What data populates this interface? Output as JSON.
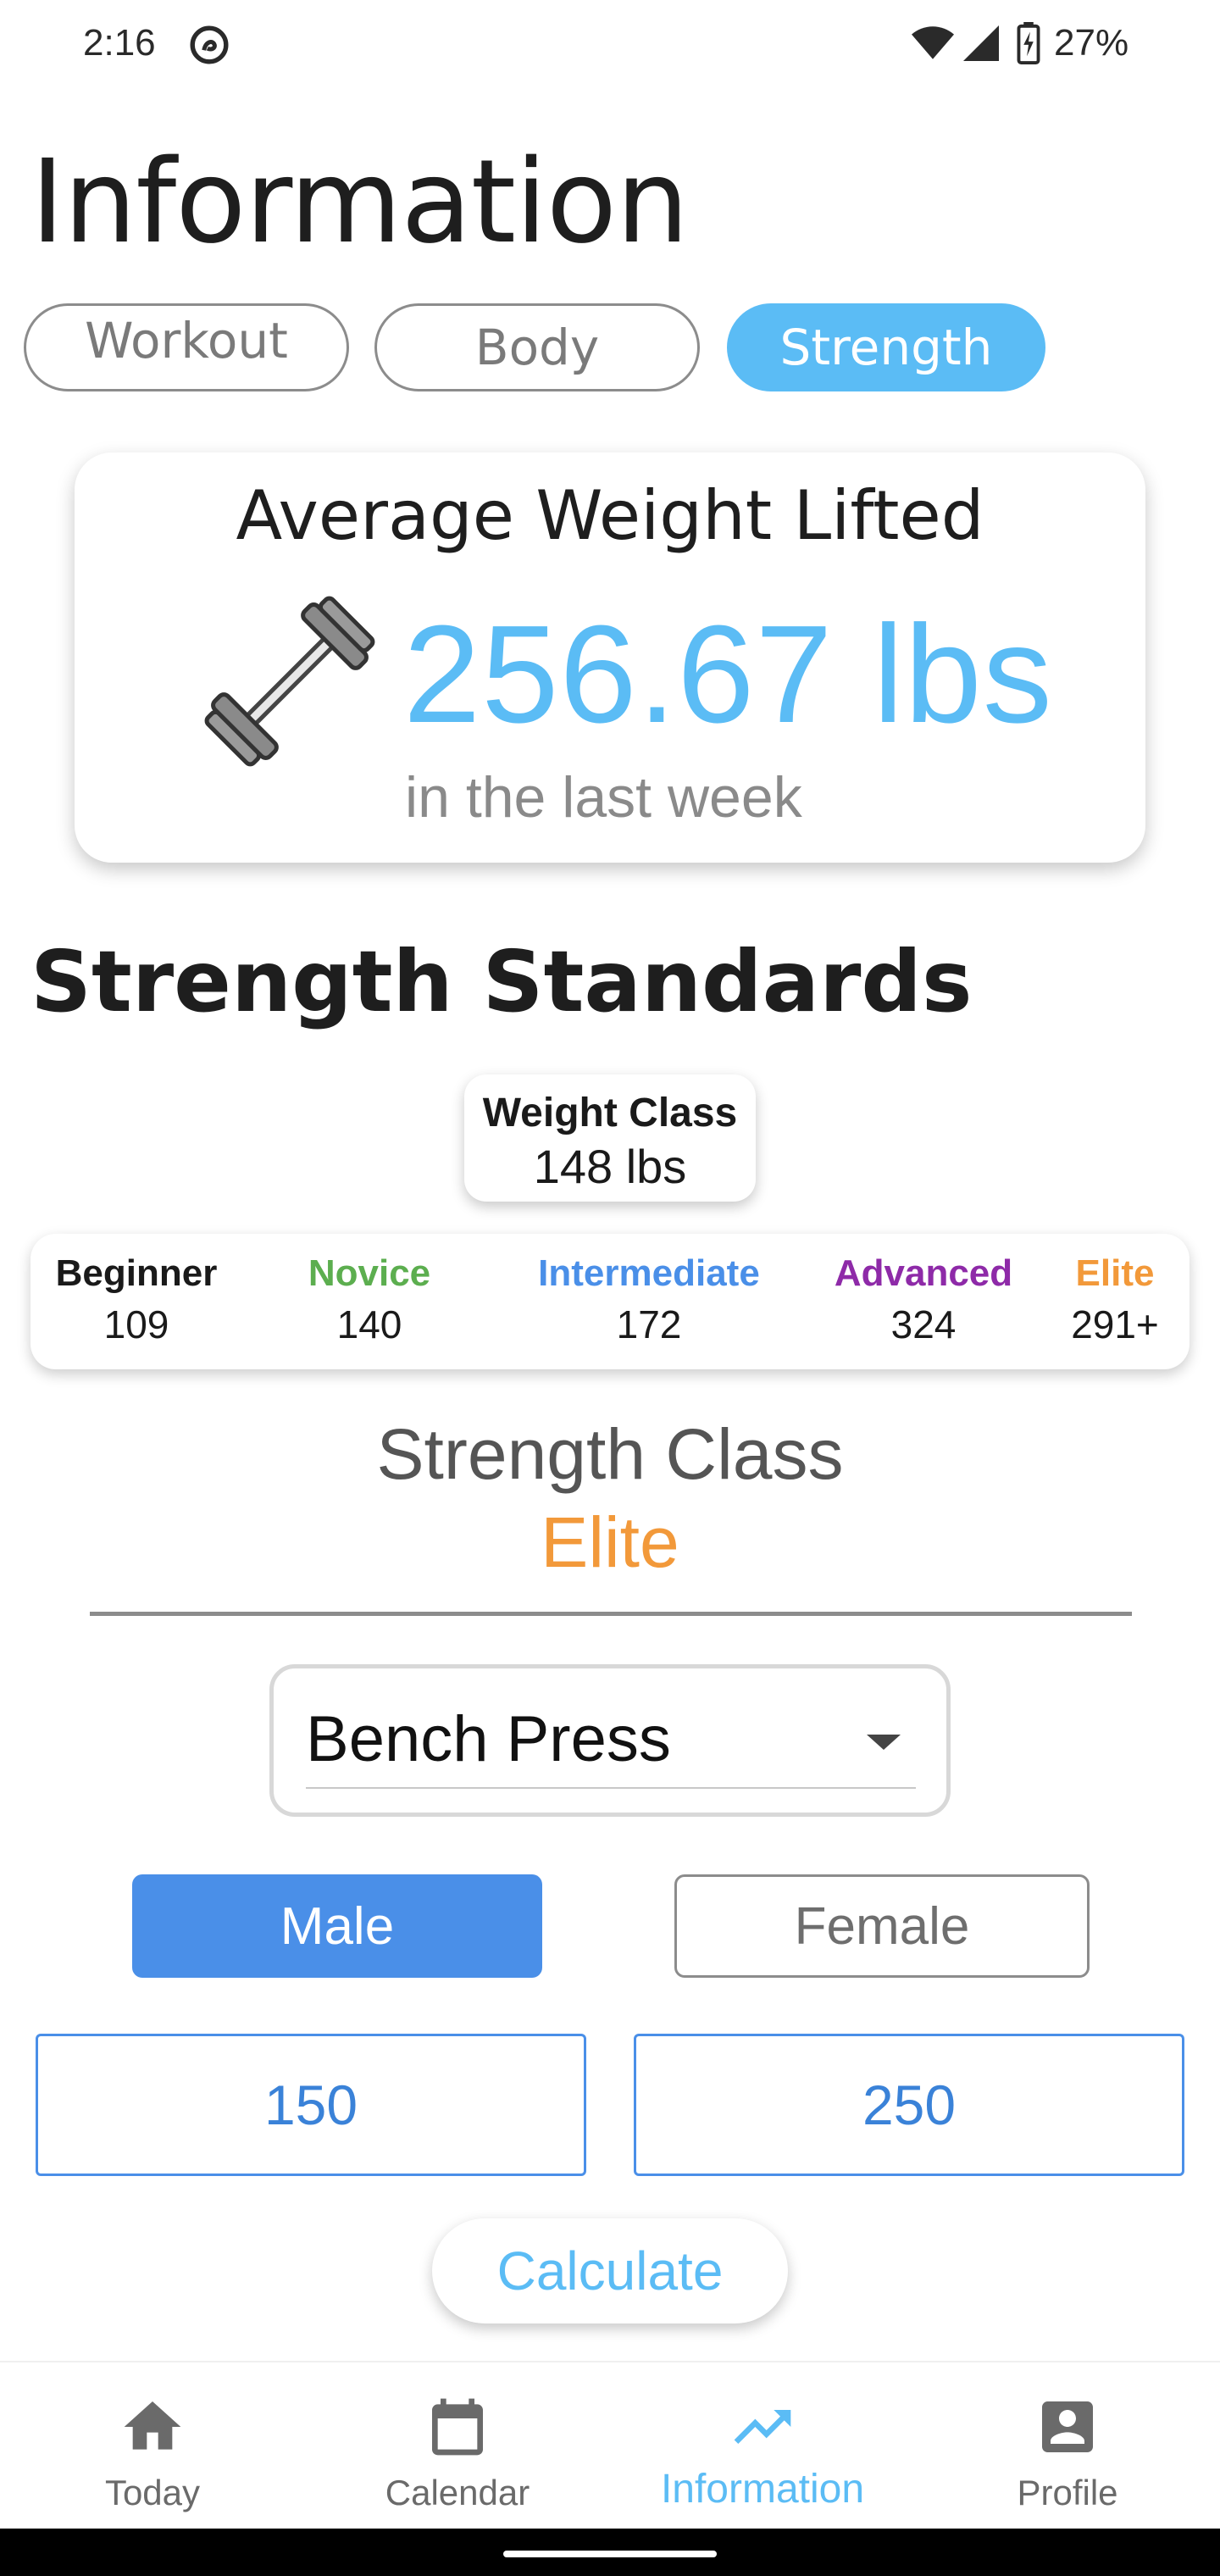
{
  "status_bar": {
    "time": "2:16",
    "battery_percent": "27%",
    "icons": [
      "do-not-disturb-icon",
      "wifi-icon",
      "cell-signal-icon",
      "battery-charging-icon"
    ]
  },
  "page": {
    "title": "Information"
  },
  "tabs": [
    {
      "label": "Workout",
      "active": false
    },
    {
      "label": "Body",
      "active": false
    },
    {
      "label": "Strength",
      "active": true
    }
  ],
  "average_card": {
    "title": "Average Weight Lifted",
    "value": "256.67 lbs",
    "subtitle": "in the last week",
    "icon": "barbell-icon"
  },
  "strength_standards": {
    "title": "Strength Standards",
    "weight_class_label": "Weight Class",
    "weight_class_value": "148 lbs",
    "levels": [
      {
        "name": "Beginner",
        "value": "109",
        "color": "#1a1a1a"
      },
      {
        "name": "Novice",
        "value": "140",
        "color": "#5cae4f"
      },
      {
        "name": "Intermediate",
        "value": "172",
        "color": "#4a8fe8"
      },
      {
        "name": "Advanced",
        "value": "324",
        "color": "#8e2aa8"
      },
      {
        "name": "Elite",
        "value": "291+",
        "color": "#f2993a"
      }
    ],
    "strength_class_label": "Strength Class",
    "strength_class_value": "Elite"
  },
  "form": {
    "exercise": "Bench Press",
    "gender_options": [
      {
        "label": "Male",
        "selected": true
      },
      {
        "label": "Female",
        "selected": false
      }
    ],
    "input_1_value": "150",
    "input_2_value": "250",
    "calculate_label": "Calculate"
  },
  "bottom_nav": [
    {
      "label": "Today",
      "icon": "home-icon",
      "active": false
    },
    {
      "label": "Calendar",
      "icon": "calendar-icon",
      "active": false
    },
    {
      "label": "Information",
      "icon": "trending-up-icon",
      "active": true
    },
    {
      "label": "Profile",
      "icon": "account-box-icon",
      "active": false
    }
  ],
  "colors": {
    "accent": "#5bbcf5",
    "primary_blue": "#4a8fe8",
    "elite_orange": "#f2993a"
  }
}
